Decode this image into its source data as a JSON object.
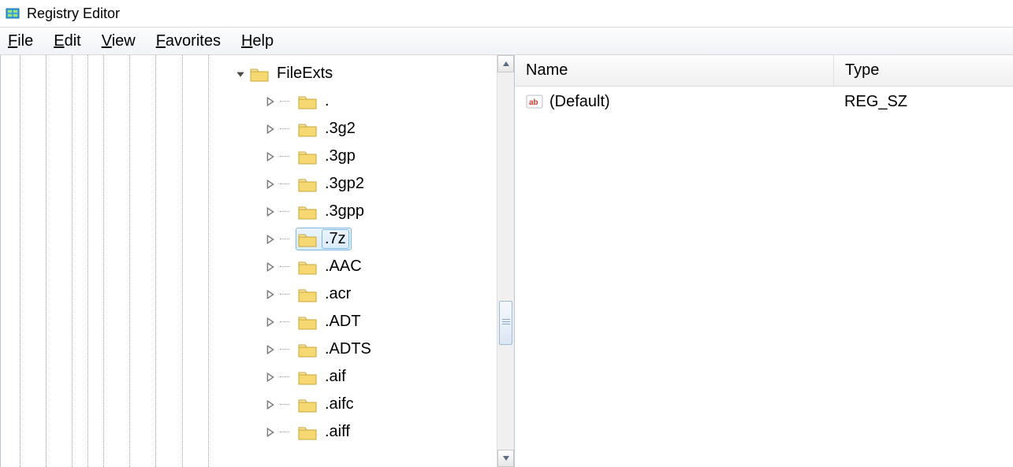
{
  "window": {
    "title": "Registry Editor"
  },
  "menu": {
    "file": {
      "label": "File",
      "accel_index": 0
    },
    "edit": {
      "label": "Edit",
      "accel_index": 0
    },
    "view": {
      "label": "View",
      "accel_index": 0
    },
    "favorites": {
      "label": "Favorites",
      "accel_index": 0
    },
    "help": {
      "label": "Help",
      "accel_index": 0
    }
  },
  "tree": {
    "expanded": {
      "label": "FileExts"
    },
    "children": [
      {
        "label": ".",
        "selected": false
      },
      {
        "label": ".3g2",
        "selected": false
      },
      {
        "label": ".3gp",
        "selected": false
      },
      {
        "label": ".3gp2",
        "selected": false
      },
      {
        "label": ".3gpp",
        "selected": false
      },
      {
        "label": ".7z",
        "selected": true
      },
      {
        "label": ".AAC",
        "selected": false
      },
      {
        "label": ".acr",
        "selected": false
      },
      {
        "label": ".ADT",
        "selected": false
      },
      {
        "label": ".ADTS",
        "selected": false
      },
      {
        "label": ".aif",
        "selected": false
      },
      {
        "label": ".aifc",
        "selected": false
      },
      {
        "label": ".aiff",
        "selected": false
      }
    ]
  },
  "list": {
    "columns": {
      "name": "Name",
      "type": "Type"
    },
    "rows": [
      {
        "name": "(Default)",
        "type": "REG_SZ",
        "icon": "string-value-icon"
      }
    ]
  }
}
